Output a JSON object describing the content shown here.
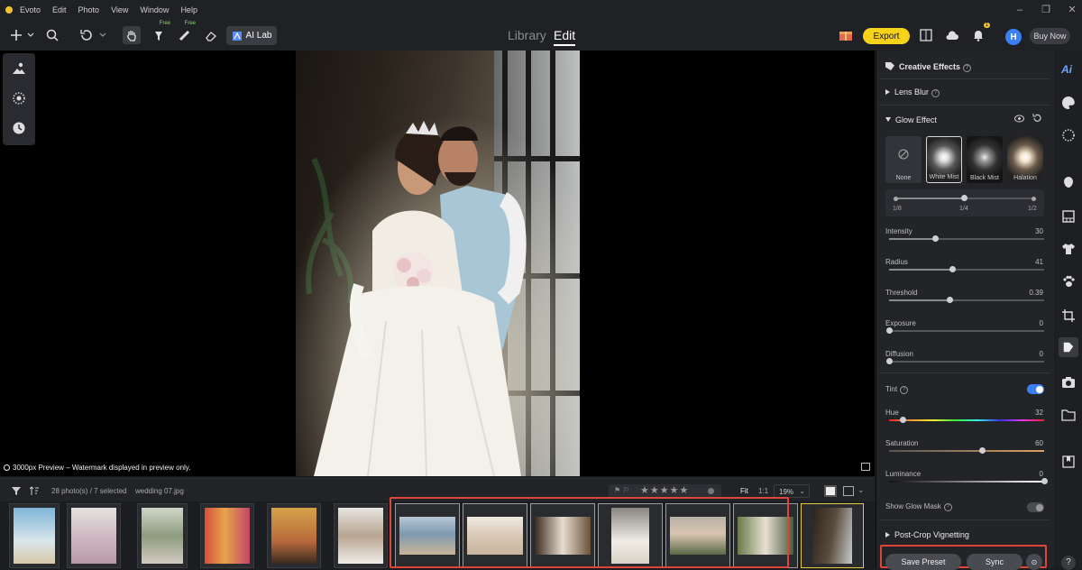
{
  "app": {
    "title": "Evoto"
  },
  "menu": [
    "Edit",
    "Photo",
    "View",
    "Window",
    "Help"
  ],
  "toolbar": {
    "ai_lab": "AI Lab",
    "free_badge": "Free",
    "tabs": {
      "library": "Library",
      "edit": "Edit"
    },
    "export": "Export",
    "buy_now": "Buy Now",
    "avatar_initial": "H",
    "notification_count": "1"
  },
  "preview_note": "3000px Preview – Watermark displayed in preview only.",
  "filmstrip": {
    "count": "28 photo(s) / 7 selected",
    "filename": "wedding 07.jpg",
    "fit": "Fit",
    "one_to_one": "1:1",
    "zoom": "19%"
  },
  "panel": {
    "title": "Creative Effects",
    "lens_blur": "Lens Blur",
    "glow_effect": "Glow Effect",
    "presets": [
      "None",
      "White Mist",
      "Black Mist",
      "Halation"
    ],
    "active_preset": "White Mist",
    "strength_ticks": [
      "1/8",
      "1/4",
      "1/2"
    ],
    "strength_value": 0.5,
    "sliders": [
      {
        "label": "Intensity",
        "value": "30",
        "fraction": 0.3
      },
      {
        "label": "Radius",
        "value": "41",
        "fraction": 0.41
      },
      {
        "label": "Threshold",
        "value": "0.39",
        "fraction": 0.39
      },
      {
        "label": "Exposure",
        "value": "0",
        "fraction": 0.0
      },
      {
        "label": "Diffusion",
        "value": "0",
        "fraction": 0.0
      }
    ],
    "tint": {
      "label": "Tint",
      "enabled": true
    },
    "tint_sliders": [
      {
        "label": "Hue",
        "value": "32",
        "fraction": 0.09
      },
      {
        "label": "Saturation",
        "value": "60",
        "fraction": 0.6
      },
      {
        "label": "Luminance",
        "value": "0",
        "fraction": 1.0
      }
    ],
    "show_glow_mask": {
      "label": "Show Glow Mask",
      "enabled": false
    },
    "post_crop": "Post-Crop Vignetting",
    "save_preset": "Save Preset",
    "sync": "Sync"
  },
  "colors": {
    "accent": "#f7d21b",
    "selection_outline": "#e0453a",
    "toggle_on": "#3b7ff5"
  }
}
